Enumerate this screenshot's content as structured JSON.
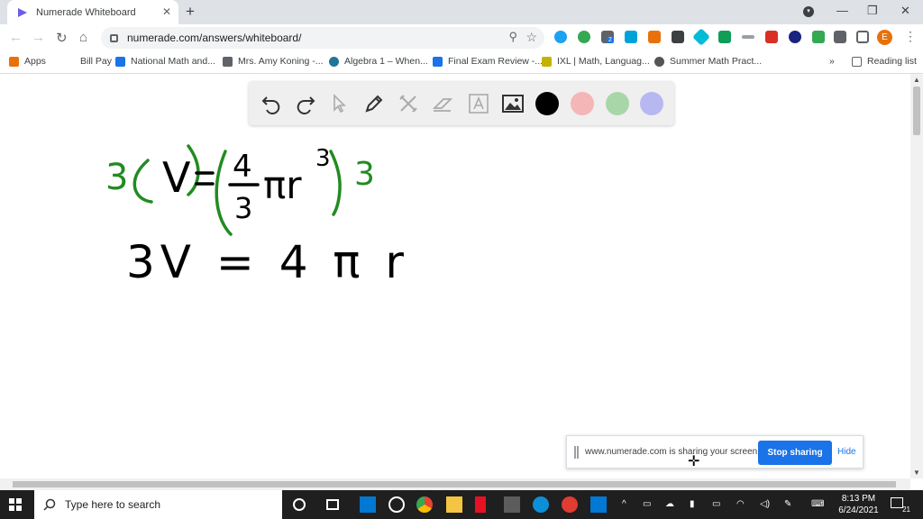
{
  "tab": {
    "title": "Numerade Whiteboard",
    "close": "✕",
    "new_tab": "+"
  },
  "window": {
    "minimize": "—",
    "restore": "❐",
    "close": "✕"
  },
  "address": {
    "url": "numerade.com/answers/whiteboard/"
  },
  "nav": {
    "back": "←",
    "forward": "→",
    "reload": "↻",
    "home": "⌂"
  },
  "bookmarks": [
    {
      "label": "Apps",
      "color": "#e8710a"
    },
    {
      "label": "Bill Pay",
      "color": "#ffffff"
    },
    {
      "label": "National Math and...",
      "color": "#1a73e8"
    },
    {
      "label": "Mrs. Amy Koning -...",
      "color": "#5f6368"
    },
    {
      "label": "Algebra 1 – When...",
      "color": "#21759b"
    },
    {
      "label": "Final Exam Review -...",
      "color": "#1a73e8"
    },
    {
      "label": "IXL | Math, Languag...",
      "color": "#c4b200"
    },
    {
      "label": "Summer Math Pract...",
      "color": "#555555"
    }
  ],
  "bookmarks_more": "»",
  "reading_list": "Reading list",
  "profile_initial": "E",
  "ext_badge": "2",
  "whiteboard": {
    "colors": {
      "black": "#000000",
      "pink": "#f4b6b6",
      "green": "#a9d6a9",
      "purple": "#b7b7f2"
    },
    "ink": {
      "green": "#228b22",
      "black": "#000000"
    },
    "math": {
      "line1_mult": "3",
      "line1_V": "V",
      "line1_eq": "=",
      "frac_num": "4",
      "frac_den": "3",
      "pi_r": "πr",
      "exp": "3",
      "line1_rhs_mult": "3",
      "line2": "3V = 4 π r"
    }
  },
  "share": {
    "message": "www.numerade.com is sharing your screen.",
    "stop": "Stop sharing",
    "hide": "Hide"
  },
  "taskbar": {
    "search_placeholder": "Type here to search",
    "time": "8:13 PM",
    "date": "6/24/2021",
    "notif_count": "21"
  }
}
